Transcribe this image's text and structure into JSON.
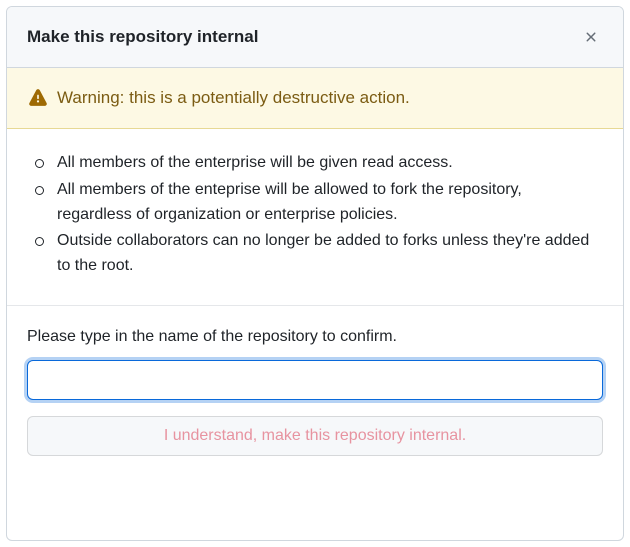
{
  "modal": {
    "title": "Make this repository internal",
    "warning": {
      "text": "Warning: this is a potentially destructive action."
    },
    "info_items": [
      "All members of the enterprise will be given read access.",
      "All members of the enteprise will be allowed to fork the repository, regardless of organization or enterprise policies.",
      "Outside collaborators can no longer be added to forks unless they're added to the root."
    ],
    "confirm_label": "Please type in the name of the repository to confirm.",
    "confirm_input_value": "",
    "confirm_button_label": "I understand, make this repository internal."
  }
}
